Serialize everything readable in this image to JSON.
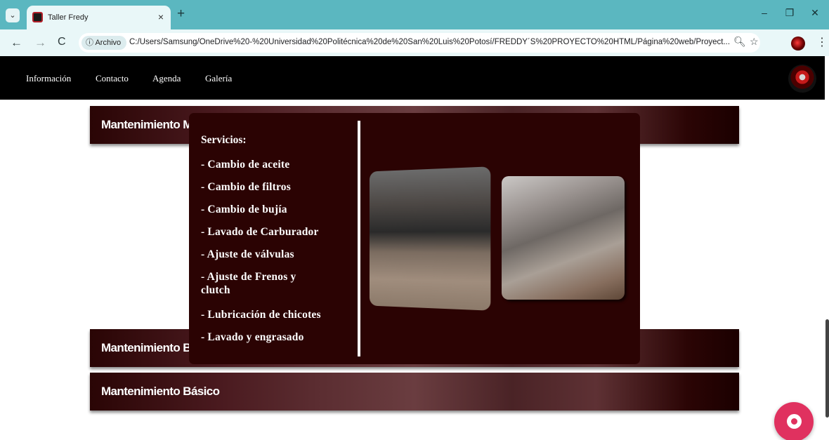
{
  "browser": {
    "tab_title": "Taller Fredy",
    "tab_close": "×",
    "new_tab": "+",
    "chip_label": "ⓘ Archivo",
    "url": "C:/Users/Samsung/OneDrive%20-%20Universidad%20Politécnica%20de%20San%20Luis%20Potosí/FREDDY´S%20PROYECTO%20HTML/Página%20web/Proyect...",
    "icons": {
      "tab_menu": "chevron-down-icon",
      "back": "back-arrow-icon",
      "forward": "forward-arrow-icon",
      "reload": "reload-icon",
      "zoom": "zoom-icon",
      "bookmark": "star-icon",
      "menu": "kebab-menu-icon"
    }
  },
  "nav": {
    "items": [
      "Información",
      "Contacto",
      "Agenda",
      "Galería"
    ]
  },
  "sections": [
    {
      "title": "Mantenimiento M"
    },
    {
      "title": "Mantenimiento B"
    },
    {
      "title": "Mantenimiento Básico"
    }
  ],
  "services": {
    "heading": "Servicios:",
    "items": [
      "- Cambio de aceite",
      "- Cambio de filtros",
      "- Cambio de bujía",
      "- Lavado de Carburador",
      "- Ajuste de válvulas",
      "- Ajuste de Frenos y clutch",
      "- Lubricación de chicotes",
      "- Lavado y engrasado"
    ]
  },
  "colors": {
    "tabbar": "#5bb7c0",
    "overlay": "#2b0303",
    "chat": "#e0315f"
  }
}
